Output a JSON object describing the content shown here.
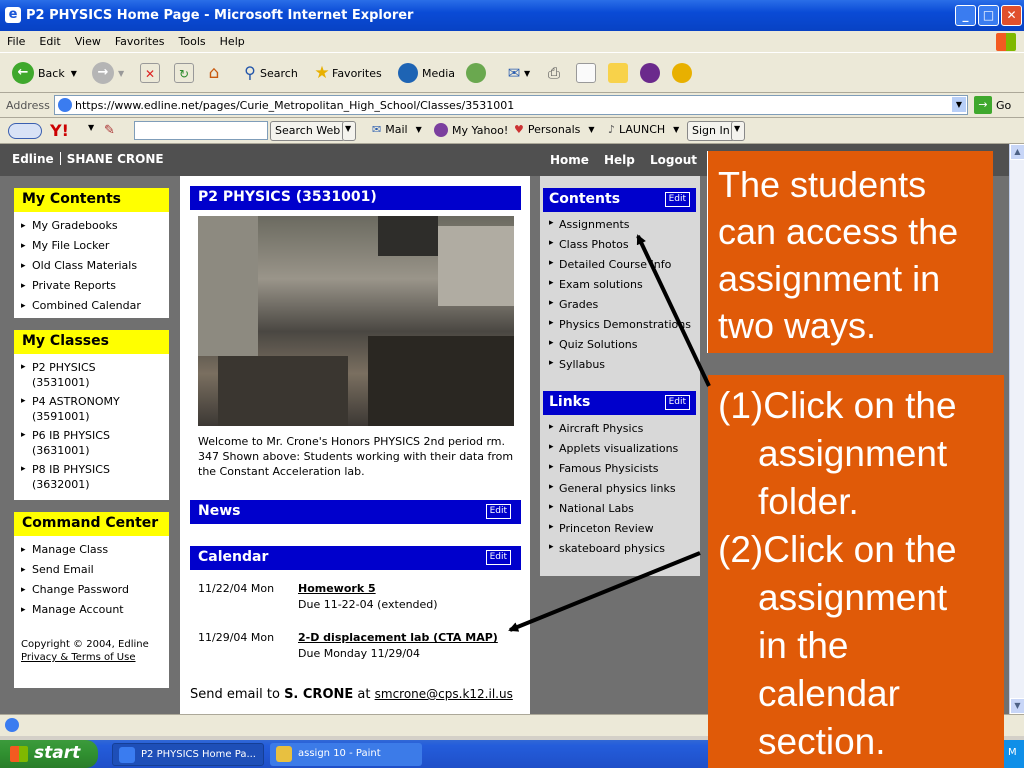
{
  "window": {
    "title": "P2 PHYSICS Home Page - Microsoft Internet Explorer",
    "min": "_",
    "max": "□",
    "close": "✕"
  },
  "menu": [
    "File",
    "Edit",
    "View",
    "Favorites",
    "Tools",
    "Help"
  ],
  "toolbar": {
    "back": "Back",
    "search": "Search",
    "favorites": "Favorites",
    "media": "Media"
  },
  "address": {
    "label": "Address",
    "url": "https://www.edline.net/pages/Curie_Metropolitan_High_School/Classes/3531001",
    "go": "Go"
  },
  "yahoo": {
    "search_web": "Search Web",
    "mail": "Mail",
    "my_yahoo": "My Yahoo!",
    "personals": "Personals",
    "launch": "LAUNCH",
    "sign_in": "Sign In"
  },
  "edline": {
    "brand": "Edline",
    "user": "SHANE CRONE",
    "nav": [
      "Home",
      "Help",
      "Logout"
    ]
  },
  "my_contents": {
    "title": "My Contents",
    "items": [
      "My Gradebooks",
      "My File Locker",
      "Old Class Materials",
      "Private Reports",
      "Combined Calendar"
    ]
  },
  "my_classes": {
    "title": "My Classes",
    "items": [
      {
        "name": "P2 PHYSICS",
        "code": "(3531001)"
      },
      {
        "name": "P4 ASTRONOMY",
        "code": "(3591001)"
      },
      {
        "name": "P6 IB PHYSICS",
        "code": "(3631001)"
      },
      {
        "name": "P8 IB PHYSICS",
        "code": "(3632001)"
      }
    ]
  },
  "command_center": {
    "title": "Command Center",
    "items": [
      "Manage Class",
      "Send Email",
      "Change Password",
      "Manage Account"
    ],
    "copyright": "Copyright © 2004, Edline",
    "privacy": "Privacy & Terms of Use"
  },
  "main": {
    "class_title": "P2 PHYSICS (3531001)",
    "welcome": "Welcome to Mr. Crone's Honors PHYSICS 2nd period rm. 347 Shown above: Students working with their data from the Constant Acceleration lab.",
    "news_title": "News",
    "calendar_title": "Calendar",
    "edit": "Edit",
    "calendar": [
      {
        "date": "11/22/04 Mon",
        "title": "Homework 5",
        "detail": "Due 11-22-04 (extended)"
      },
      {
        "date": "11/29/04 Mon",
        "title": "2-D displacement lab (CTA MAP)",
        "detail": "Due Monday 11/29/04"
      }
    ],
    "email_prefix": "Send email to",
    "email_name": "S. CRONE",
    "email_at": "at",
    "email": "smcrone@cps.k12.il.us"
  },
  "contents": {
    "title": "Contents",
    "items": [
      "Assignments",
      "Class Photos",
      "Detailed Course Info",
      "Exam solutions",
      "Grades",
      "Physics Demonstrations",
      "Quiz Solutions",
      "Syllabus"
    ]
  },
  "links": {
    "title": "Links",
    "items": [
      "Aircraft Physics",
      "Applets visualizations",
      "Famous Physicists",
      "General physics links",
      "National Labs",
      "Princeton Review",
      "skateboard physics"
    ]
  },
  "taskbar": {
    "start": "start",
    "tasks": [
      "P2 PHYSICS Home Pa...",
      "assign 10 - Paint"
    ],
    "clock": "M"
  },
  "callouts": {
    "intro": "The students can access the assignment in two ways.",
    "lines": [
      "(1)Click on the",
      "assignment",
      "folder.",
      "(2)Click on the",
      "assignment",
      "in the",
      "calendar",
      "section."
    ]
  },
  "colors": {
    "callout": "#e05a08",
    "edline_blue": "#0000cc",
    "highlight_yellow": "#ffff00"
  }
}
